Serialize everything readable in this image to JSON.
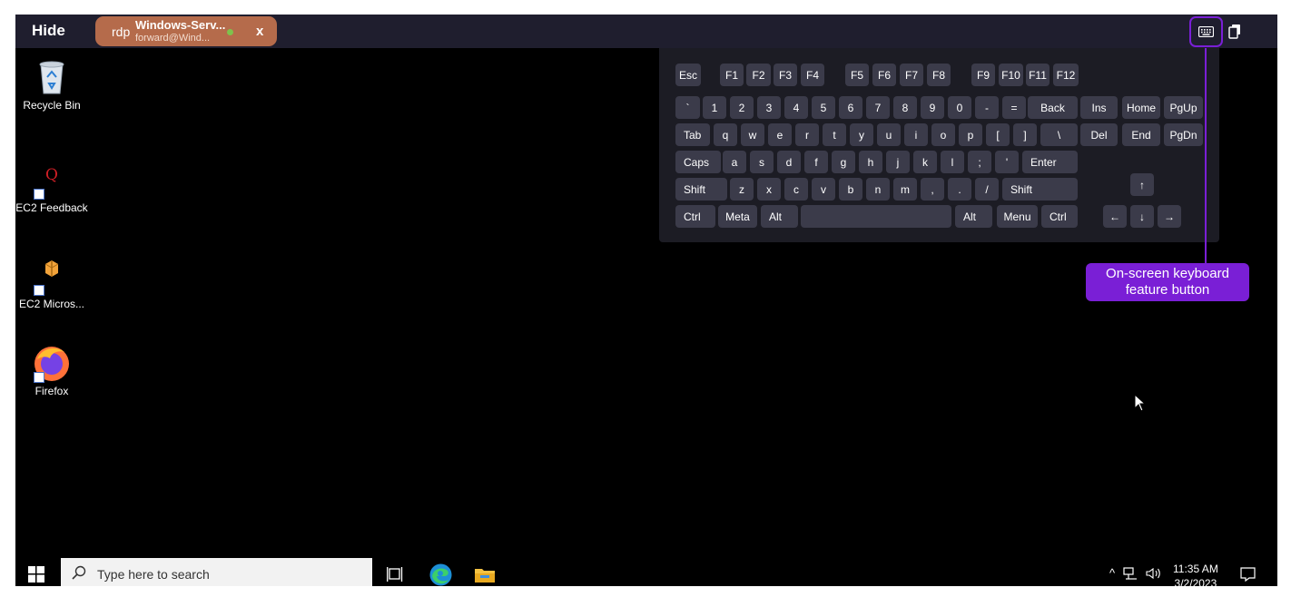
{
  "toolbar": {
    "hide_label": "Hide",
    "connection": {
      "protocol": "rdp",
      "name": "Windows-Serv...",
      "user": "forward@Wind...",
      "close_label": "x",
      "status_color": "#7fc24c"
    },
    "accent_color": "#7a1fd6"
  },
  "desktop": {
    "icons": [
      {
        "label": "Recycle Bin",
        "icon": "recycle-bin-icon"
      },
      {
        "label": "EC2 Feedback",
        "icon": "ec2-feedback-icon"
      },
      {
        "label": "EC2 Micros...",
        "icon": "ec2-microsoft-icon"
      },
      {
        "label": "Firefox",
        "icon": "firefox-icon"
      }
    ]
  },
  "keyboard": {
    "rows": [
      [
        "Esc",
        "F1",
        "F2",
        "F3",
        "F4",
        "F5",
        "F6",
        "F7",
        "F8",
        "F9",
        "F10",
        "F11",
        "F12"
      ],
      [
        "`",
        "1",
        "2",
        "3",
        "4",
        "5",
        "6",
        "7",
        "8",
        "9",
        "0",
        "-",
        "=",
        "Back",
        "Ins",
        "Home",
        "PgUp"
      ],
      [
        "Tab",
        "q",
        "w",
        "e",
        "r",
        "t",
        "y",
        "u",
        "i",
        "o",
        "p",
        "[",
        "]",
        "\\",
        "Del",
        "End",
        "PgDn"
      ],
      [
        "Caps",
        "a",
        "s",
        "d",
        "f",
        "g",
        "h",
        "j",
        "k",
        "l",
        ";",
        "'",
        "Enter"
      ],
      [
        "Shift",
        "z",
        "x",
        "c",
        "v",
        "b",
        "n",
        "m",
        ",",
        ".",
        "/",
        "Shift",
        "↑"
      ],
      [
        "Ctrl",
        "Meta",
        "Alt",
        "",
        "Alt",
        "Menu",
        "Ctrl",
        "←",
        "↓",
        "→"
      ]
    ]
  },
  "callout": {
    "line1": "On-screen keyboard",
    "line2": "feature button"
  },
  "taskbar": {
    "search_placeholder": "Type here to search",
    "time": "11:35 AM",
    "date": "3/2/2023"
  }
}
